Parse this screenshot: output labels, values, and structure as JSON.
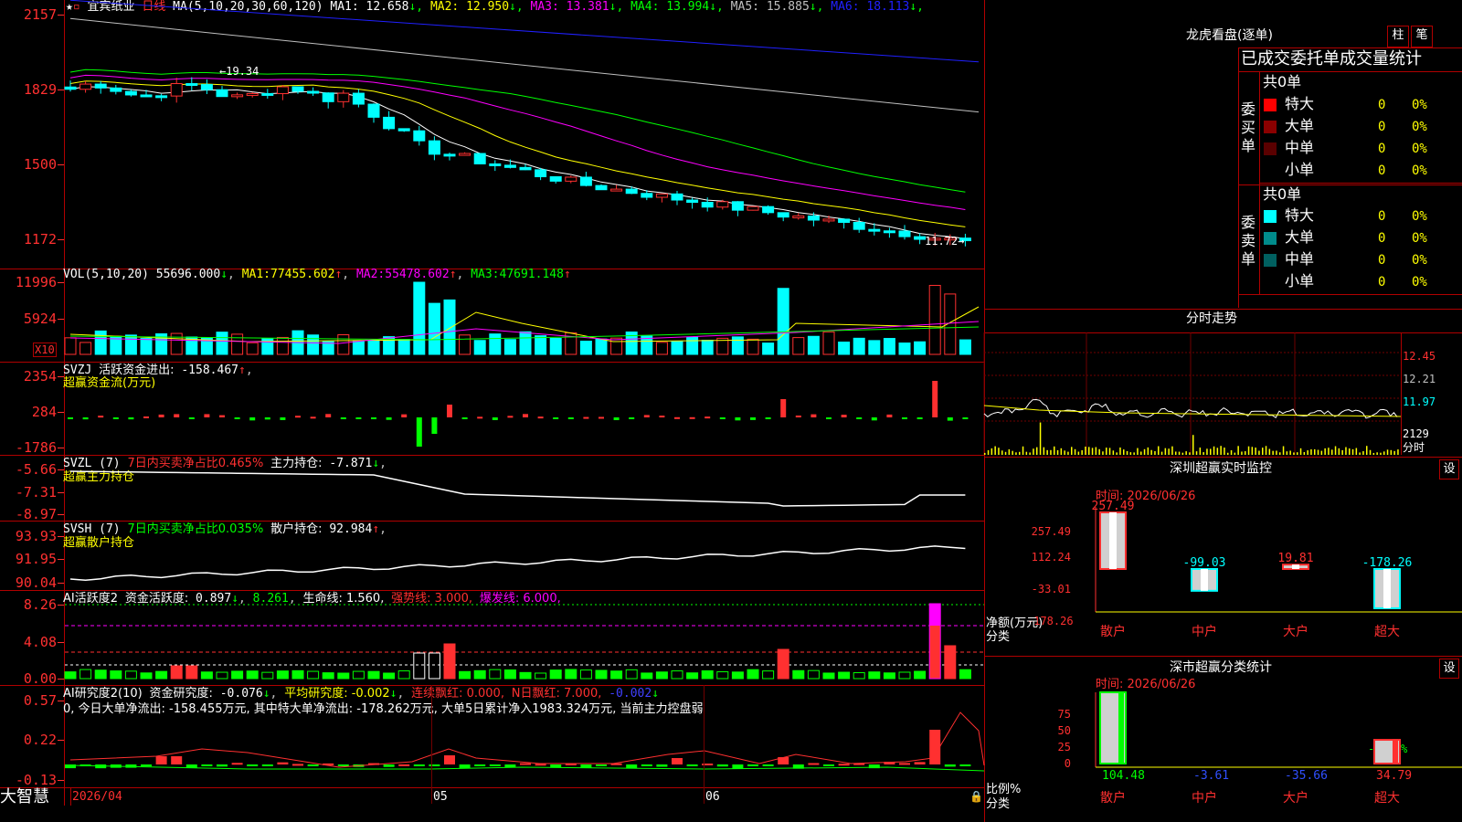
{
  "main": {
    "stock_name": "宜宾纸业",
    "period": "日线",
    "ma_label": "MA(5,10,20,30,60,120)",
    "ma": [
      {
        "name": "MA1:",
        "value": "12.658",
        "color": "#ffffff"
      },
      {
        "name": "MA2:",
        "value": "12.950",
        "color": "#ffff00"
      },
      {
        "name": "MA3:",
        "value": "13.381",
        "color": "#ff00ff"
      },
      {
        "name": "MA4:",
        "value": "13.994",
        "color": "#00ff00"
      },
      {
        "name": "MA5:",
        "value": "15.885",
        "color": "#c0c0c0"
      },
      {
        "name": "MA6:",
        "value": "18.113",
        "color": "#2020ff"
      }
    ],
    "arrow": "↓",
    "yticks": [
      "2157",
      "1829",
      "1500",
      "1172"
    ],
    "high_label": "19.34",
    "low_label": "11.72"
  },
  "vol": {
    "label": "VOL(5,10,20)",
    "value": "55696.000",
    "ma1_name": "MA1:",
    "ma1_value": "77455.602",
    "ma2_name": "MA2:",
    "ma2_value": "55478.602",
    "ma3_name": "MA3:",
    "ma3_value": "47691.148",
    "yticks": [
      "11996",
      "5924"
    ],
    "unit": "X10"
  },
  "svzj": {
    "label": "SVZJ",
    "name": "活跃资金进出:",
    "value": "-158.467",
    "sub": "超赢资金流(万元)",
    "yticks": [
      "2354",
      "284",
      "-1786"
    ]
  },
  "svzl": {
    "label": "SVZL (7)",
    "ratio": "7日内买卖净占比0.465%",
    "name": "主力持仓:",
    "value": "-7.871",
    "sub": "超赢主力持仓",
    "yticks": [
      "-5.66",
      "-7.31",
      "-8.97"
    ]
  },
  "svsh": {
    "label": "SVSH (7)",
    "ratio": "7日内买卖净占比0.035%",
    "name": "散户持仓:",
    "value": "92.984",
    "sub": "超赢散户持仓",
    "yticks": [
      "93.93",
      "91.95",
      "90.04"
    ]
  },
  "ai_active": {
    "label": "AI活跃度2",
    "name": "资金活跃度:",
    "value": "0.897",
    "value2": "8.261",
    "life": "生命线: 1.560,",
    "strong": "强势线: 3.000,",
    "burst": "爆发线: 6.000,",
    "yticks": [
      "8.26",
      "4.08",
      "0.00"
    ]
  },
  "ai_research": {
    "label": "AI研究度2(10)",
    "name": "资金研究度:",
    "value": "-0.076",
    "avg": "平均研究度: -0.002",
    "red_name": "连续飘红: 0.000,",
    "n_red": "N日飘红: 7.000,",
    "last": "-0.002",
    "sentence": "0, 今日大单净流出: -158.455万元, 其中特大单净流出: -178.262万元, 大单5日累计净入1983.324万元, 当前主力控盘弱",
    "yticks": [
      "0.57",
      "0.22",
      "-0.13"
    ]
  },
  "xaxis": {
    "labels": [
      "2026/04",
      "05",
      "06"
    ]
  },
  "brand": "大智慧",
  "right": {
    "dragon_title": "龙虎看盘(逐单)",
    "btn_pillar": "柱",
    "btn_pen": "笔",
    "table_header": "已成交委托单成交量统计",
    "buy_total": "共0单",
    "sell_total": "共0单",
    "buy_label": "委买单",
    "sell_label": "委卖单",
    "buy_rows": [
      {
        "name": "特大",
        "count": "0",
        "pct": "0%",
        "color": "#ff0000"
      },
      {
        "name": "大单",
        "count": "0",
        "pct": "0%",
        "color": "#8b0000"
      },
      {
        "name": "中单",
        "count": "0",
        "pct": "0%",
        "color": "#5a0000"
      },
      {
        "name": "小单",
        "count": "0",
        "pct": "0%",
        "color": ""
      }
    ],
    "sell_rows": [
      {
        "name": "特大",
        "count": "0",
        "pct": "0%",
        "color": "#00ffff"
      },
      {
        "name": "大单",
        "count": "0",
        "pct": "0%",
        "color": "#008b8b"
      },
      {
        "name": "中单",
        "count": "0",
        "pct": "0%",
        "color": "#006060"
      },
      {
        "name": "小单",
        "count": "0",
        "pct": "0%",
        "color": ""
      }
    ],
    "intraday_title": "分时走势",
    "intraday_prices": [
      "12.45",
      "12.21",
      "11.97"
    ],
    "intraday_vol": "2129",
    "intraday_unit": "分时",
    "monitor_title": "深圳超赢实时监控",
    "monitor_btn": "设",
    "monitor_time": "时间: 2026/06/26",
    "monitor_yticks": [
      "257.49",
      "112.24",
      "-33.01",
      "-178.26"
    ],
    "monitor_ylabel": "净额(万元)",
    "monitor_xlabel": "分类",
    "monitor_bars": [
      {
        "name": "散户",
        "value": 257.49,
        "label": "257.49"
      },
      {
        "name": "中户",
        "value": -99.03,
        "label": "-99.03"
      },
      {
        "name": "大户",
        "value": 19.81,
        "label": "19.81"
      },
      {
        "name": "超大",
        "value": -178.26,
        "label": "-178.26"
      }
    ],
    "stats_title": "深市超赢分类统计",
    "stats_btn": "设",
    "stats_time": "时间: 2026/06/26",
    "stats_yticks": [
      "75",
      "50",
      "25",
      "0"
    ],
    "stats_ylabel": "比例%",
    "stats_xlabel": "分类",
    "stats_bars": [
      {
        "name": "散户",
        "value": 104.48,
        "label": "104.48"
      },
      {
        "name": "中户",
        "value": -3.61,
        "label": "-3.61"
      },
      {
        "name": "大户",
        "value": -35.66,
        "label": "-35.66"
      },
      {
        "name": "超大",
        "value": 34.79,
        "label": "34.79"
      }
    ],
    "stats_note": "-0.09%"
  },
  "chart_data": {
    "type": "bar",
    "title": "深圳超赢实时监控",
    "categories": [
      "散户",
      "中户",
      "大户",
      "超大"
    ],
    "values": [
      257.49,
      -99.03,
      19.81,
      -178.26
    ],
    "ylabel": "净额(万元)",
    "xlabel": "分类",
    "ylim": [
      -178.26,
      257.49
    ]
  }
}
